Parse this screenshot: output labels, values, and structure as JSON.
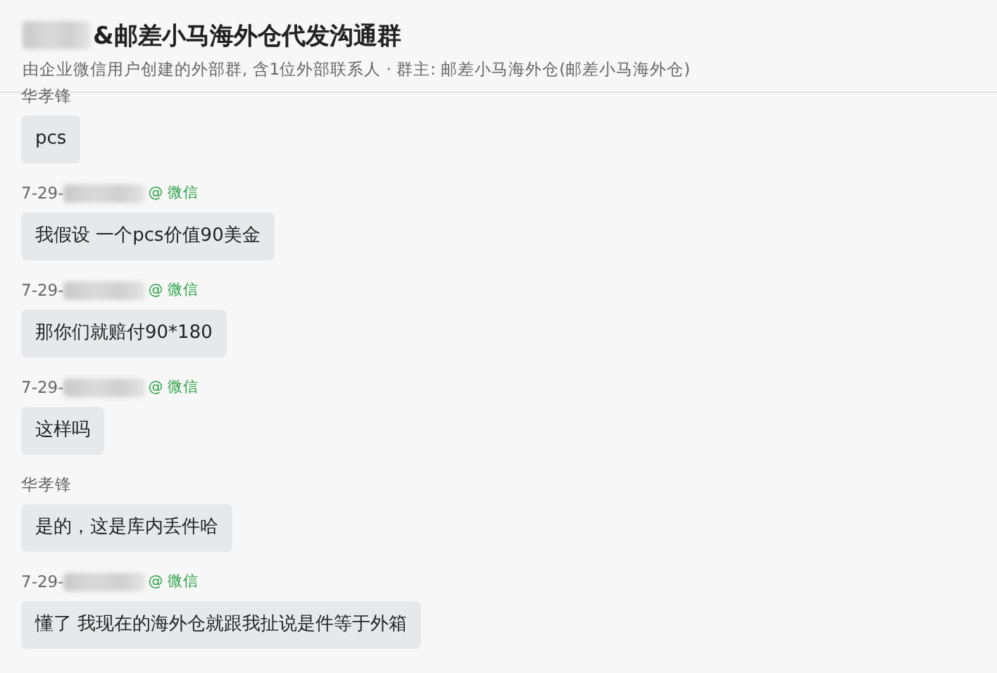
{
  "header": {
    "title_redacted": true,
    "title": "&邮差小马海外仓代发沟通群",
    "subtitle": "由企业微信用户创建的外部群, 含1位外部联系人 · 群主: 邮差小马海外仓(邮差小马海外仓)"
  },
  "messages": [
    {
      "sender": "华孝锋",
      "sender_redacted": false,
      "text": "pcs",
      "cut_top": true
    },
    {
      "sender": "7-29-",
      "sender_redacted": true,
      "source": "@ 微信",
      "text": "我假设 一个pcs价值90美金"
    },
    {
      "sender": "7-29-",
      "sender_redacted": true,
      "source": "@ 微信",
      "text": "那你们就赔付90*180"
    },
    {
      "sender": "7-29-",
      "sender_redacted": true,
      "source": "@ 微信",
      "text": "这样吗"
    },
    {
      "sender": "华孝锋",
      "sender_redacted": false,
      "text": "是的，这是库内丢件哈"
    },
    {
      "sender": "7-29-",
      "sender_redacted": true,
      "source": "@ 微信",
      "text": "懂了 我现在的海外仓就跟我扯说是件等于外箱"
    }
  ]
}
